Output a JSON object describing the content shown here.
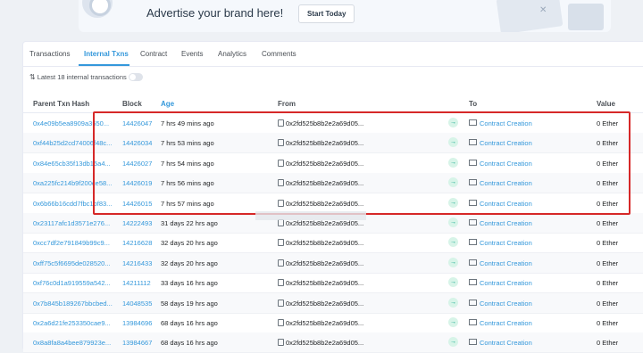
{
  "banner": {
    "text": "Advertise your brand here!",
    "button": "Start Today"
  },
  "tabs": [
    "Transactions",
    "Internal Txns",
    "Contract",
    "Events",
    "Analytics",
    "Comments"
  ],
  "active_tab": "Internal Txns",
  "summary": "Latest 18 internal transactions",
  "columns": {
    "hash": "Parent Txn Hash",
    "block": "Block",
    "age": "Age",
    "from": "From",
    "to": "To",
    "value": "Value"
  },
  "rows": [
    {
      "hash": "0x4e09b5ea8909a3550...",
      "block": "14426047",
      "age": "7 hrs 49 mins ago",
      "from": "0x2fd525b8b2e2a69d05...",
      "to": "Contract Creation",
      "value": "0 Ether"
    },
    {
      "hash": "0xf44b25d2cd74006f48c...",
      "block": "14426034",
      "age": "7 hrs 53 mins ago",
      "from": "0x2fd525b8b2e2a69d05...",
      "to": "Contract Creation",
      "value": "0 Ether"
    },
    {
      "hash": "0x84e65cb35f13db15a4...",
      "block": "14426027",
      "age": "7 hrs 54 mins ago",
      "from": "0x2fd525b8b2e2a69d05...",
      "to": "Contract Creation",
      "value": "0 Ether"
    },
    {
      "hash": "0xa225fc214b9f200ce58...",
      "block": "14426019",
      "age": "7 hrs 56 mins ago",
      "from": "0x2fd525b8b2e2a69d05...",
      "to": "Contract Creation",
      "value": "0 Ether"
    },
    {
      "hash": "0x6b66b16cdd7fbc1bf83...",
      "block": "14426015",
      "age": "7 hrs 57 mins ago",
      "from": "0x2fd525b8b2e2a69d05...",
      "to": "Contract Creation",
      "value": "0 Ether"
    },
    {
      "hash": "0x23117afc1d3571e276...",
      "block": "14222493",
      "age": "31 days 22 hrs ago",
      "from": "0x2fd525b8b2e2a69d05...",
      "to": "Contract Creation",
      "value": "0 Ether"
    },
    {
      "hash": "0xcc7df2e791849b99c9...",
      "block": "14216628",
      "age": "32 days 20 hrs ago",
      "from": "0x2fd525b8b2e2a69d05...",
      "to": "Contract Creation",
      "value": "0 Ether"
    },
    {
      "hash": "0xff75c5f6695de028520...",
      "block": "14216433",
      "age": "32 days 20 hrs ago",
      "from": "0x2fd525b8b2e2a69d05...",
      "to": "Contract Creation",
      "value": "0 Ether"
    },
    {
      "hash": "0xf76c0d1a919559a542...",
      "block": "14211112",
      "age": "33 days 16 hrs ago",
      "from": "0x2fd525b8b2e2a69d05...",
      "to": "Contract Creation",
      "value": "0 Ether"
    },
    {
      "hash": "0x7b845b189267bbcbed...",
      "block": "14048535",
      "age": "58 days 19 hrs ago",
      "from": "0x2fd525b8b2e2a69d05...",
      "to": "Contract Creation",
      "value": "0 Ether"
    },
    {
      "hash": "0x2a6d21fe253350cae9...",
      "block": "13984696",
      "age": "68 days 16 hrs ago",
      "from": "0x2fd525b8b2e2a69d05...",
      "to": "Contract Creation",
      "value": "0 Ether"
    },
    {
      "hash": "0x8a8fa8a4bee879923e...",
      "block": "13984667",
      "age": "68 days 16 hrs ago",
      "from": "0x2fd525b8b2e2a69d05...",
      "to": "Contract Creation",
      "value": "0 Ether"
    }
  ]
}
